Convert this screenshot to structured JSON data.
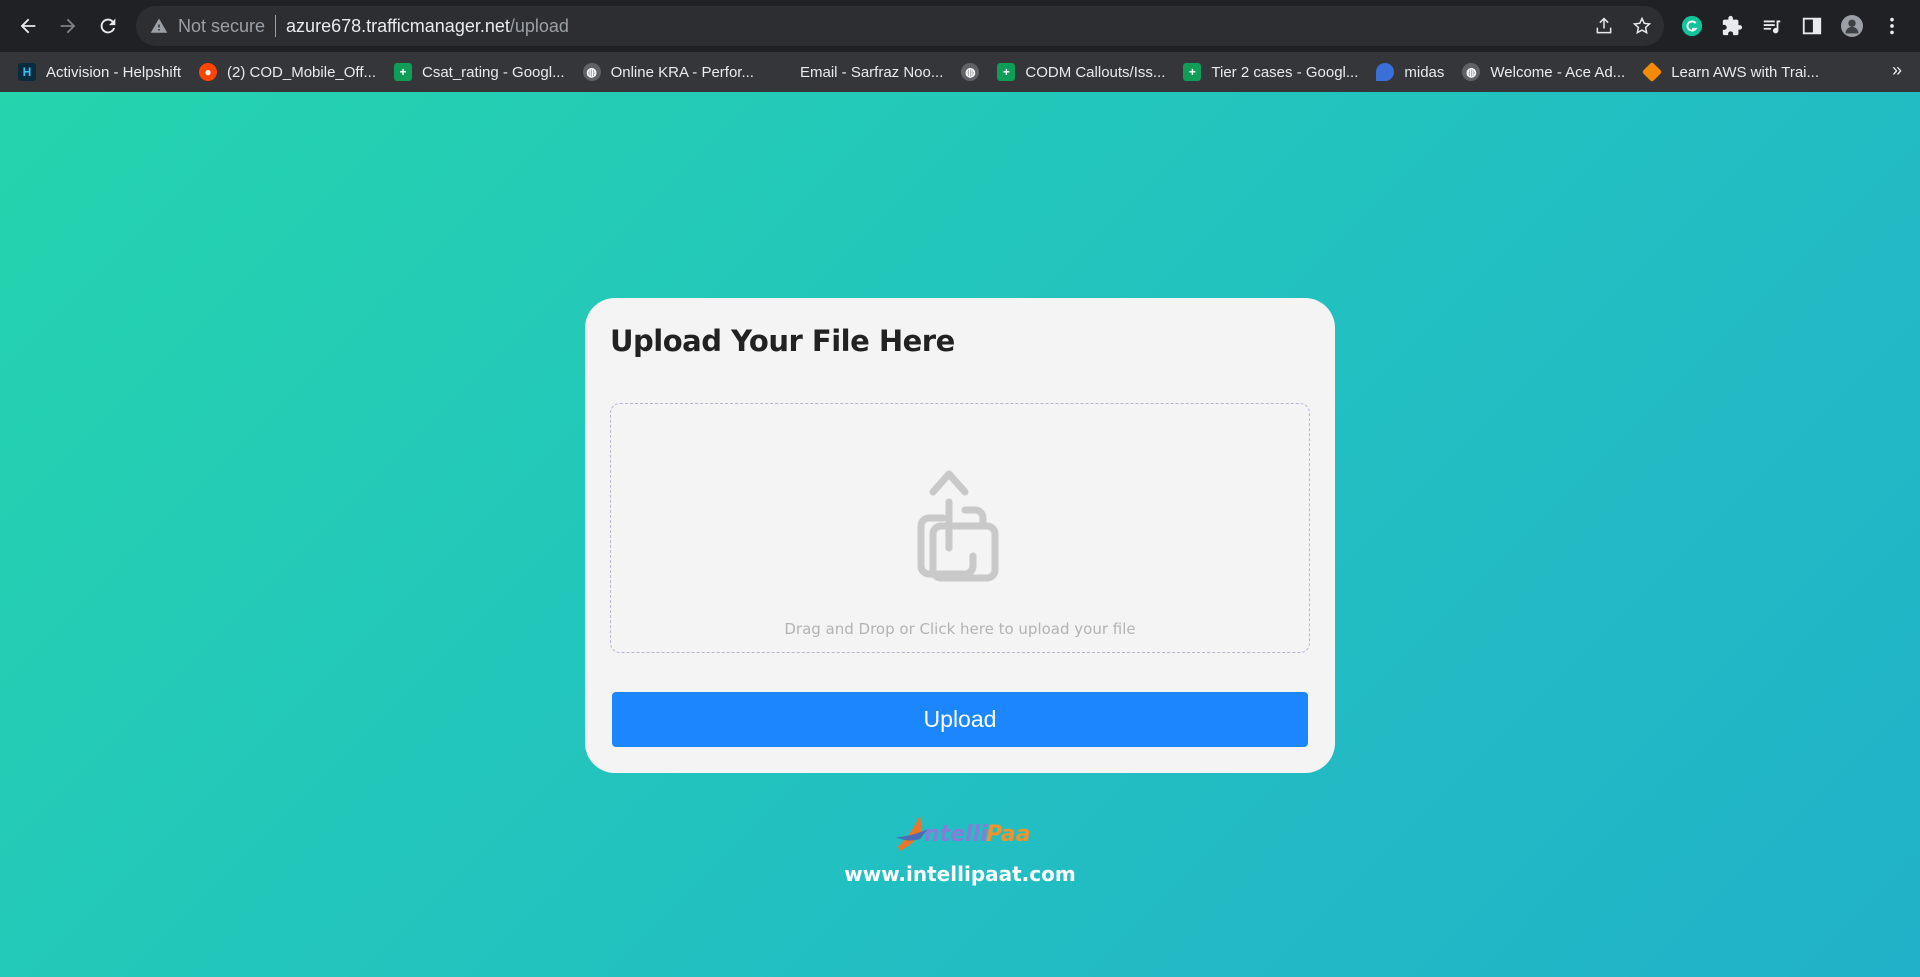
{
  "browser": {
    "security_label": "Not secure",
    "url_host": "azure678.trafficmanager.net",
    "url_path": "/upload",
    "bookmarks": [
      {
        "label": "Activision - Helpshift",
        "icon": "helpshift-icon",
        "color": "#0b2a3d"
      },
      {
        "label": "(2) COD_Mobile_Off...",
        "icon": "reddit-icon",
        "color": "#ff4500"
      },
      {
        "label": "Csat_rating - Googl...",
        "icon": "google-sheets-icon",
        "color": "#0f9d58"
      },
      {
        "label": "Online KRA - Perfor...",
        "icon": "globe-icon",
        "color": "#9aa0a6"
      },
      {
        "label": "Email - Sarfraz Noo...",
        "icon": "microsoft-icon",
        "color": "#f25022"
      },
      {
        "label": "",
        "icon": "globe-icon",
        "color": "#9aa0a6"
      },
      {
        "label": "CODM Callouts/Iss...",
        "icon": "google-sheets-icon",
        "color": "#0f9d58"
      },
      {
        "label": "Tier 2 cases - Googl...",
        "icon": "google-sheets-icon",
        "color": "#0f9d58"
      },
      {
        "label": "midas",
        "icon": "midas-icon",
        "color": "#3b6fd8"
      },
      {
        "label": "Welcome - Ace Ad...",
        "icon": "globe-icon",
        "color": "#9aa0a6"
      },
      {
        "label": "Learn AWS with Trai...",
        "icon": "aws-cube-icon",
        "color": "#f58a07"
      }
    ],
    "more_bookmarks": "»"
  },
  "page": {
    "title": "Upload Your File Here",
    "dropzone_text": "Drag and Drop or Click here to upload your file",
    "upload_button": "Upload",
    "logo_text": "IntelliPaat",
    "site_url": "www.intellipaat.com"
  },
  "colors": {
    "accent": "#1c86ff",
    "background_start": "#25d4ad",
    "background_end": "#21b1c9"
  }
}
